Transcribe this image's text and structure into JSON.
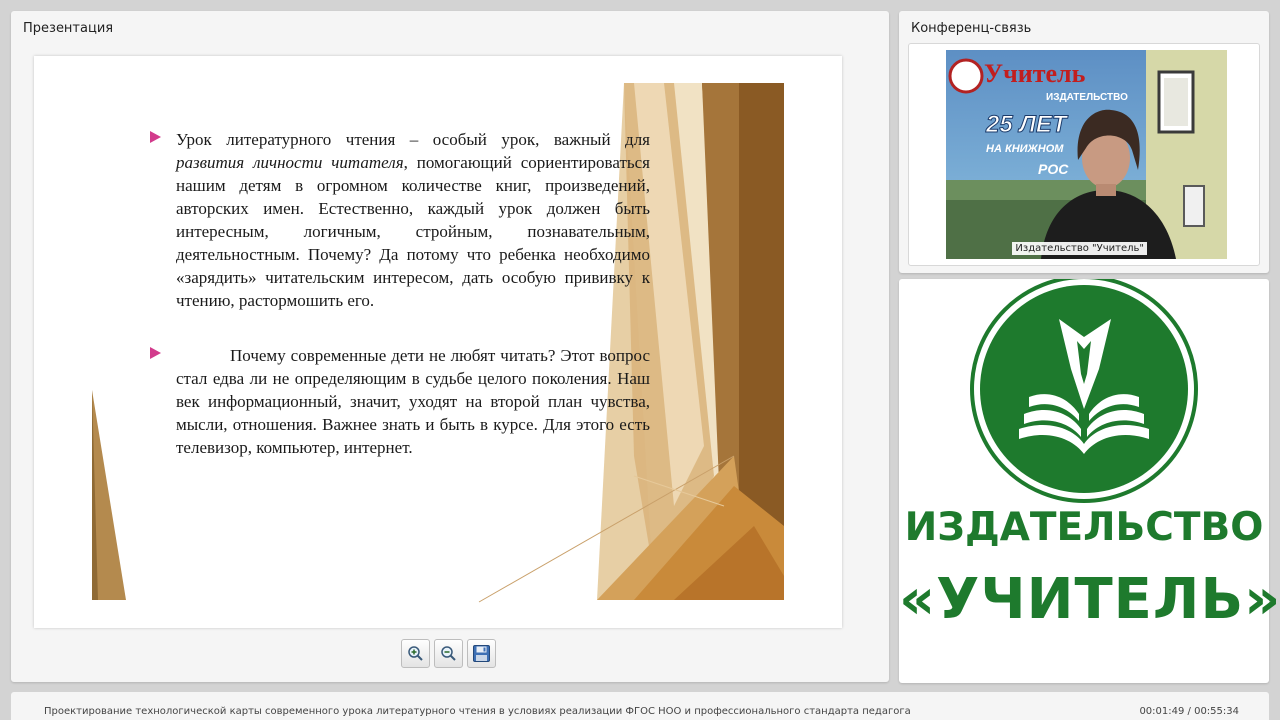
{
  "presentation": {
    "title": "Презентация",
    "slide": {
      "bullets": [
        {
          "parts": [
            {
              "text": "Урок литературного чтения – особый урок, важный для ",
              "italic": false
            },
            {
              "text": "развития личности читателя",
              "italic": true
            },
            {
              "text": ", помогающий сориентироваться нашим детям в огромном количестве книг, произведений, авторских имен. Естественно, каждый урок должен быть интересным, логичным, стройным, познавательным, деятельностным. Почему? Да потому что ребенка необходимо «зарядить» читательским интересом, дать особую прививку к чтению, растормошить его.",
              "italic": false
            }
          ]
        },
        {
          "parts": [
            {
              "text": "Почему современные дети не любят читать? Этот вопрос стал едва ли не определяющим в судьбе целого поколения. Наш век информационный, значит, уходят на второй план чувства, мысли, отношения. Важнее знать и быть в курсе. Для этого есть телевизор, компьютер, интернет.",
              "italic": false
            }
          ]
        }
      ]
    },
    "toolbar": {
      "zoom_in_icon": "zoom-in-icon",
      "zoom_out_icon": "zoom-out-icon",
      "save_icon": "floppy-disk-icon"
    }
  },
  "conference": {
    "title": "Конференц-связь",
    "video_caption": "Издательство \"Учитель\"",
    "banner": {
      "brand": "Учитель",
      "sub": "ИЗДАТЕЛЬСТВО",
      "years": "25 ЛЕТ",
      "line": "НА КНИЖНОМ",
      "country": "РОС"
    }
  },
  "logo": {
    "line1": "ИЗДАТЕЛЬСТВО",
    "line2": "«УЧИТЕЛЬ»",
    "color": "#1e7a2d"
  },
  "status": {
    "title": "Проектирование технологической карты современного урока литературного чтения в условиях реализации ФГОС НОО и профессионального стандарта педагога",
    "time": "00:01:49 / 00:55:34"
  }
}
